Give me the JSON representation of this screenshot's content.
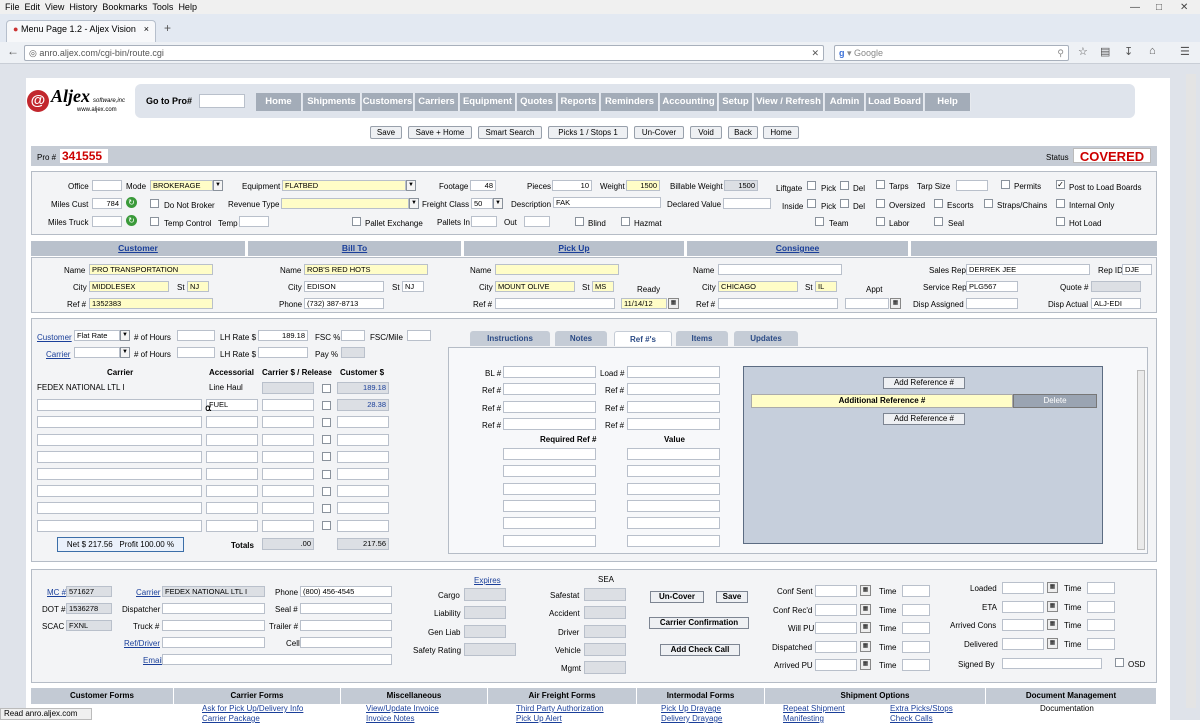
{
  "browser": {
    "menu": [
      "File",
      "Edit",
      "View",
      "History",
      "Bookmarks",
      "Tools",
      "Help"
    ],
    "tab_title": "Menu Page 1.2 - Aljex Vision",
    "new_tab": "+",
    "url": "anro.aljex.com/cgi-bin/route.cgi",
    "url_domain": "aljex.com",
    "search_placeholder": "Google",
    "status": "Read anro.aljex.com"
  },
  "logo": {
    "brand": "Aljex",
    "sub": "software,inc",
    "site": "www.aljex.com"
  },
  "goto": {
    "label": "Go to Pro#"
  },
  "nav": [
    "Home",
    "Shipments",
    "Customers",
    "Carriers",
    "Equipment",
    "Quotes",
    "Reports",
    "Reminders",
    "Accounting",
    "Setup",
    "View / Refresh",
    "Admin",
    "Load Board",
    "Help"
  ],
  "actions": [
    "Save",
    "Save + Home",
    "Smart Search",
    "Picks 1 / Stops 1",
    "Un-Cover",
    "Void",
    "Back",
    "Home"
  ],
  "pro": {
    "label": "Pro #",
    "value": "341555",
    "status_label": "Status",
    "status": "COVERED"
  },
  "top": {
    "office": "Office",
    "mode": "Mode",
    "mode_val": "BROKERAGE",
    "equipment": "Equipment",
    "equipment_val": "FLATBED",
    "footage": "Footage",
    "footage_val": "48",
    "pieces": "Pieces",
    "pieces_val": "10",
    "weight": "Weight",
    "weight_val": "1500",
    "billable_weight": "Billable Weight",
    "billable_val": "1500",
    "liftgate": "Liftgate",
    "pick": "Pick",
    "del": "Del",
    "tarps": "Tarps",
    "tarp_size": "Tarp Size",
    "permits": "Permits",
    "post_to_load": "Post to Load Boards",
    "miles_cust": "Miles Cust",
    "miles_cust_val": "784",
    "do_not_broker": "Do Not Broker",
    "revenue_type": "Revenue Type",
    "freight_class": "Freight Class",
    "freight_class_val": "50",
    "description": "Description",
    "description_val": "FAK",
    "declared_value": "Declared Value",
    "inside": "Inside",
    "oversized": "Oversized",
    "escorts": "Escorts",
    "straps": "Straps/Chains",
    "internal_only": "Internal Only",
    "miles_truck": "Miles Truck",
    "temp_control": "Temp Control",
    "temp": "Temp",
    "pallet_exchange": "Pallet Exchange",
    "pallets_in": "Pallets In",
    "out": "Out",
    "blind": "Blind",
    "hazmat": "Hazmat",
    "team": "Team",
    "labor": "Labor",
    "seal": "Seal",
    "hot_load": "Hot Load"
  },
  "sections": {
    "customer": "Customer",
    "bill_to": "Bill To",
    "pick_up": "Pick Up",
    "consignee": "Consignee"
  },
  "customer": {
    "name_label": "Name",
    "name": "PRO TRANSPORTATION",
    "city_label": "City",
    "city": "MIDDLESEX",
    "st_label": "St",
    "st": "NJ",
    "ref_label": "Ref #",
    "ref": "1352383"
  },
  "billto": {
    "name_label": "Name",
    "name": "ROB'S RED HOTS",
    "city_label": "City",
    "city": "EDISON",
    "st_label": "St",
    "st": "NJ",
    "phone_label": "Phone",
    "phone": "(732) 387-8713"
  },
  "pickup": {
    "name_label": "Name",
    "city_label": "City",
    "city": "MOUNT OLIVE",
    "st_label": "St",
    "st": "MS",
    "ref_label": "Ref #",
    "ready_label": "Ready",
    "ready": "11/14/12"
  },
  "consignee": {
    "name_label": "Name",
    "city_label": "City",
    "city": "CHICAGO",
    "st_label": "St",
    "st": "IL",
    "ref_label": "Ref #",
    "appt_label": "Appt"
  },
  "reps": {
    "sales_rep": "Sales Rep",
    "sales_rep_val": "DERREK JEE",
    "rep_id": "Rep ID",
    "rep_id_val": "DJE",
    "service_rep": "Service Rep",
    "service_rep_val": "PLG567",
    "quote": "Quote #",
    "disp_assigned": "Disp Assigned",
    "disp_actual": "Disp Actual",
    "disp_actual_val": "ALJ-EDI"
  },
  "rates": {
    "customer_link": "Customer",
    "flat_rate": "Flat Rate",
    "hours": "# of Hours",
    "lh_rate": "LH Rate $",
    "lh_rate_val": "189.18",
    "fsc_pct": "FSC %",
    "fsc_mile": "FSC/Mile",
    "carrier_link": "Carrier",
    "pay_pct": "Pay %"
  },
  "charges": {
    "h_carrier": "Carrier",
    "h_accessorial": "Accessorial",
    "h_release": "Carrier $ / Release",
    "h_customer": "Customer $",
    "rows": [
      {
        "carrier": "FEDEX NATIONAL LTL I",
        "acc": "Line Haul",
        "cust": "189.18"
      },
      {
        "carrier": "",
        "acc": "FUEL",
        "cust": "28.38"
      }
    ],
    "net": "Net $ 217.56   Profit 100.00 %",
    "totals": "Totals",
    "tot_carrier": ".00",
    "tot_customer": "217.56"
  },
  "tabs": [
    "Instructions",
    "Notes",
    "Ref #'s",
    "Items",
    "Updates"
  ],
  "refs": {
    "bl": "BL #",
    "load": "Load #",
    "ref": "Ref #",
    "required_ref": "Required Ref #",
    "value": "Value",
    "add_ref": "Add Reference #",
    "additional_ref": "Additional Reference #",
    "delete": "Delete"
  },
  "carrierinfo": {
    "mc": "MC #",
    "mc_val": "571627",
    "dot": "DOT #",
    "dot_val": "1536278",
    "scac": "SCAC",
    "scac_val": "FXNL",
    "carrier_link": "Carrier",
    "carrier_val": "FEDEX NATIONAL LTL I",
    "dispatcher": "Dispatcher",
    "truck": "Truck #",
    "ref_driver": "Ref/Driver",
    "email": "Email",
    "phone": "Phone",
    "phone_val": "(800) 456-4545",
    "seal": "Seal #",
    "trailer": "Trailer #",
    "cell": "Cell"
  },
  "ins": {
    "expires": "Expires",
    "cargo": "Cargo",
    "liability": "Liability",
    "gen_liab": "Gen Liab",
    "safety": "Safety Rating",
    "sea": "SEA",
    "safestat": "Safestat",
    "accident": "Accident",
    "driver": "Driver",
    "vehicle": "Vehicle",
    "mgmt": "Mgmt"
  },
  "bottombtns": {
    "uncover": "Un-Cover",
    "save": "Save",
    "carrier_conf": "Carrier Confirmation",
    "add_check": "Add Check Call"
  },
  "times": {
    "conf_sent": "Conf Sent",
    "conf_recd": "Conf Rec'd",
    "will_pu": "Will PU",
    "dispatched": "Dispatched",
    "arrived_pu": "Arrived PU",
    "time": "Time",
    "loaded": "Loaded",
    "eta": "ETA",
    "arrived_cons": "Arrived Cons",
    "delivered": "Delivered",
    "signed_by": "Signed By",
    "osd": "OSD"
  },
  "footer": {
    "tabs": [
      "Customer Forms",
      "Carrier Forms",
      "Miscellaneous",
      "Air Freight Forms",
      "Intermodal Forms",
      "Shipment Options",
      "Document Management"
    ],
    "links1": [
      "Ask for Pick Up/Delivery Info",
      "View/Update Invoice",
      "Third Party Authorization",
      "Pick Up Drayage",
      "Repeat Shipment",
      "Extra Picks/Stops",
      "Documentation"
    ],
    "links2": [
      "Carrier Package",
      "Invoice Notes",
      "Pick Up Alert",
      "Delivery Drayage",
      "Manifesting",
      "Check Calls"
    ]
  }
}
